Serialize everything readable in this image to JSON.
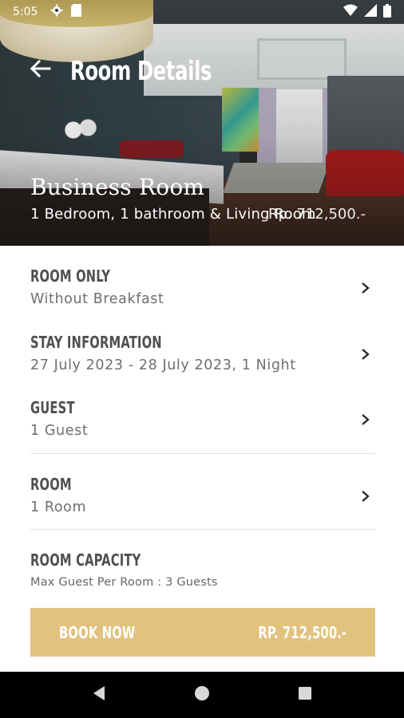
{
  "status_bar": {
    "time": "5:05",
    "icons": [
      "gear-icon",
      "sd-card-icon",
      "wifi-icon",
      "signal-icon",
      "battery-icon"
    ]
  },
  "header": {
    "title": "Room Details",
    "back_icon": "arrow-left-icon"
  },
  "room": {
    "name": "Business Room",
    "description": "1 Bedroom, 1 bathroom & Living Room",
    "price_overlay": "Rp. 712,500.-"
  },
  "details": [
    {
      "title": "ROOM ONLY",
      "value": "Without Breakfast"
    },
    {
      "title": "STAY INFORMATION",
      "value": "27 July 2023 - 28 July 2023, 1 Night"
    },
    {
      "title": "GUEST",
      "value": "1 Guest"
    },
    {
      "title": "ROOM",
      "value": "1 Room"
    }
  ],
  "capacity": {
    "title": "ROOM CAPACITY",
    "value": "Max Guest Per Room : 3 Guests"
  },
  "book": {
    "label": "BOOK NOW",
    "price": "RP. 712,500.-"
  },
  "colors": {
    "accent": "#e2c27f",
    "text_title": "#505050",
    "text_sub": "#6e6e6e"
  },
  "nav": [
    "back-triangle-icon",
    "home-circle-icon",
    "recents-square-icon"
  ]
}
